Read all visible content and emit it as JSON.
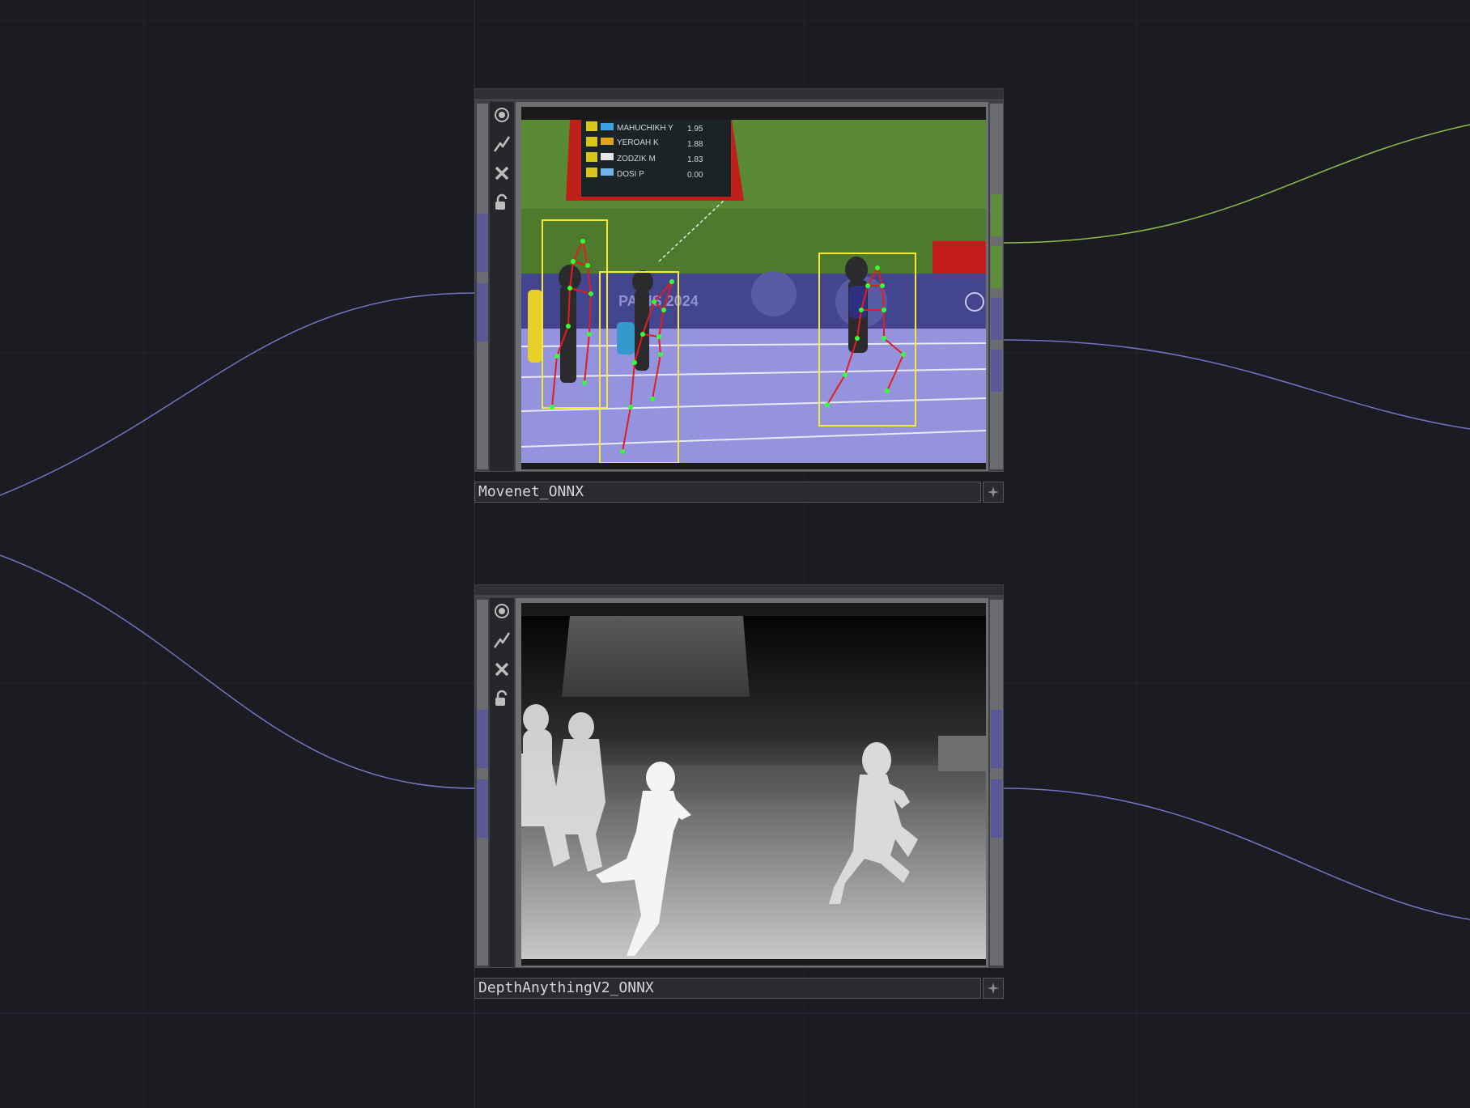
{
  "nodes": [
    {
      "name": "Movenet_ONNX",
      "tools": [
        "view-icon",
        "lightning-icon",
        "close-icon",
        "lock-icon"
      ]
    },
    {
      "name": "DepthAnythingV2_ONNX",
      "tools": [
        "view-icon",
        "lightning-icon",
        "close-icon",
        "lock-icon"
      ]
    }
  ],
  "scoreboard": {
    "rows": [
      {
        "name": "MAHUCHIKH Y",
        "value": "1.95"
      },
      {
        "name": "YEROAH K",
        "value": "1.88"
      },
      {
        "name": "ZODZIK M",
        "value": "1.83"
      },
      {
        "name": "DOSI P",
        "value": "0.00"
      }
    ],
    "banner": "PARIS 2024"
  },
  "colors": {
    "background": "#1b1c21",
    "wire_purple": "#7771c6",
    "wire_green": "#8dbf4c",
    "port_purple": "#5b5896",
    "port_green": "#5f8b3c",
    "bbox": "#f2e93a",
    "skeleton": "#e31d1d",
    "keypoint": "#33ff33"
  }
}
